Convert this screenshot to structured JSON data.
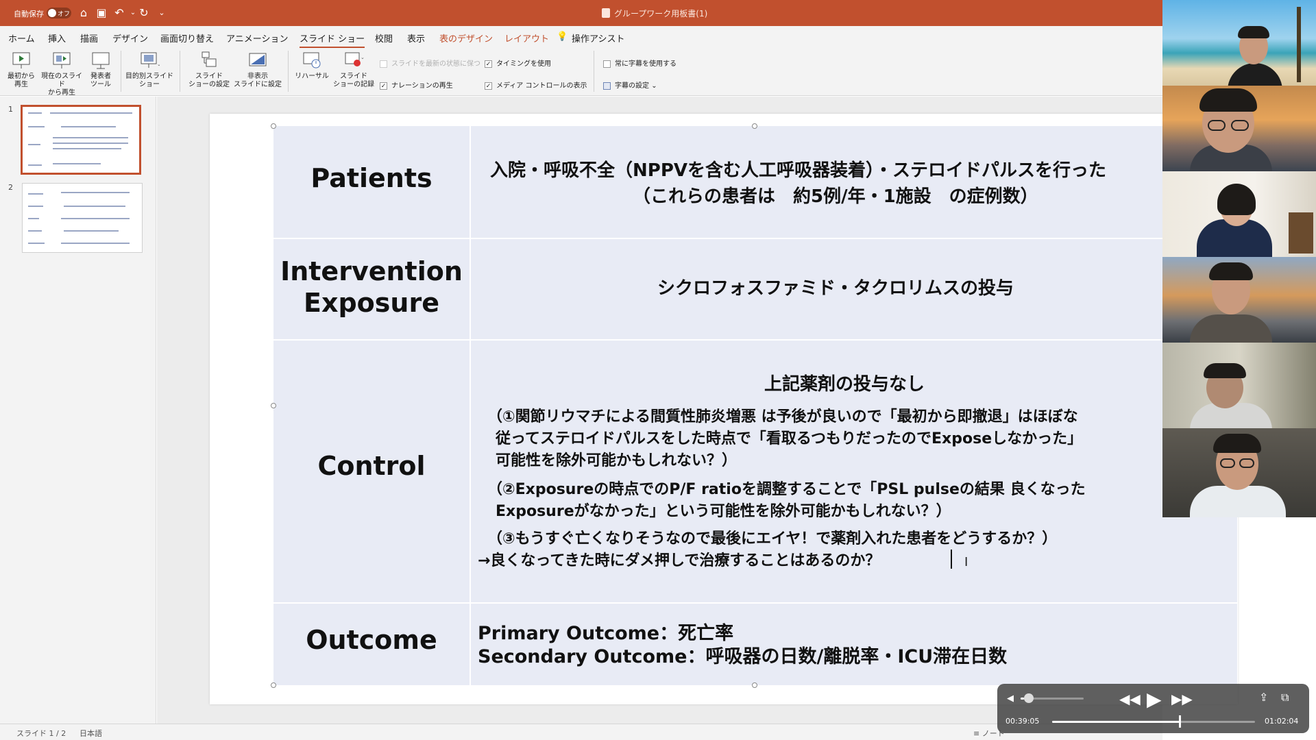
{
  "titlebar": {
    "autosave_label": "自動保存",
    "toggle_state": "オフ",
    "doc_title": "グループワーク用板書(1)"
  },
  "tabs": [
    {
      "label": "ホーム"
    },
    {
      "label": "挿入"
    },
    {
      "label": "描画"
    },
    {
      "label": "デザイン"
    },
    {
      "label": "画面切り替え"
    },
    {
      "label": "アニメーション"
    },
    {
      "label": "スライド ショー"
    },
    {
      "label": "校閲"
    },
    {
      "label": "表示"
    },
    {
      "label": "表のデザイン"
    },
    {
      "label": "レイアウト"
    },
    {
      "label": "操作アシスト"
    }
  ],
  "ribbon": {
    "tools": [
      {
        "label1": "最初から",
        "label2": "再生",
        "label3": ""
      },
      {
        "label1": "現在のスライド",
        "label2": "から再生",
        "label3": ""
      },
      {
        "label1": "発表者",
        "label2": "ツール",
        "label3": ""
      },
      {
        "label1": "目的別スライド",
        "label2": "ショー",
        "label3": ""
      },
      {
        "label1": "スライド",
        "label2": "ショーの設定",
        "label3": ""
      },
      {
        "label1": "非表示",
        "label2": "スライドに設定",
        "label3": ""
      },
      {
        "label1": "リハーサル",
        "label2": "",
        "label3": ""
      },
      {
        "label1": "スライド",
        "label2": "ショーの記録",
        "label3": ""
      }
    ],
    "checks": {
      "keep_updated": "スライドを最新の状態に保つ",
      "use_timing": "タイミングを使用",
      "play_narration": "ナレーションの再生",
      "show_media_controls": "メディア コントロールの表示",
      "always_subtitles": "常に字幕を使用する",
      "subtitle_settings": "字幕の設定"
    }
  },
  "thumbnails": [
    {
      "num": "1"
    },
    {
      "num": "2"
    }
  ],
  "slide": {
    "labels": {
      "patients": "Patients",
      "intervention1": "Intervention",
      "intervention2": "Exposure",
      "control": "Control",
      "outcome": "Outcome"
    },
    "patients_line1": "入院・呼吸不全（NPPVを含む人工呼吸器装着）・ステロイドパルスを行った",
    "patients_line2": "（これらの患者は　約5例/年・1施設　の症例数）",
    "intervention_text": "シクロフォスファミド・タクロリムスの投与",
    "control_title": "上記薬剤の投与なし",
    "control_lines": [
      "（①関節リウマチによる間質性肺炎増悪 は予後が良いので「最初から即撤退」はほぼな",
      "従ってステロイドパルスをした時点で「看取るつもりだったのでExposeしなかった」",
      "可能性を除外可能かもしれない？）",
      "（②Exposureの時点でのP/F ratioを調整することで「PSL pulseの結果 良くなった",
      "Exposureがなかった」という可能性を除外可能かもしれない？）",
      "（③もうすぐ亡くなりそうなので最後にエイヤ！で薬剤入れた患者をどうするか？）",
      "→良くなってきた時にダメ押しで治療することはあるのか？"
    ],
    "outcome_line1": "Primary Outcome：死亡率",
    "outcome_line2": "Secondary Outcome：呼吸器の日数/離脱率・ICU滞在日数"
  },
  "statusbar": {
    "slide_count": "スライド 1 / 2",
    "language": "日本語",
    "notes": "ノート"
  },
  "media": {
    "elapsed": "00:39:05",
    "total": "01:02:04",
    "progress": 0.63,
    "volume": 0.05
  },
  "participants": [
    {
      "name": "participant-1"
    },
    {
      "name": "participant-2"
    },
    {
      "name": "participant-3"
    },
    {
      "name": "participant-4"
    },
    {
      "name": "participant-5"
    },
    {
      "name": "participant-6"
    }
  ],
  "colors": {
    "accent": "#c1502e",
    "table_bg": "#e8ebf5"
  }
}
